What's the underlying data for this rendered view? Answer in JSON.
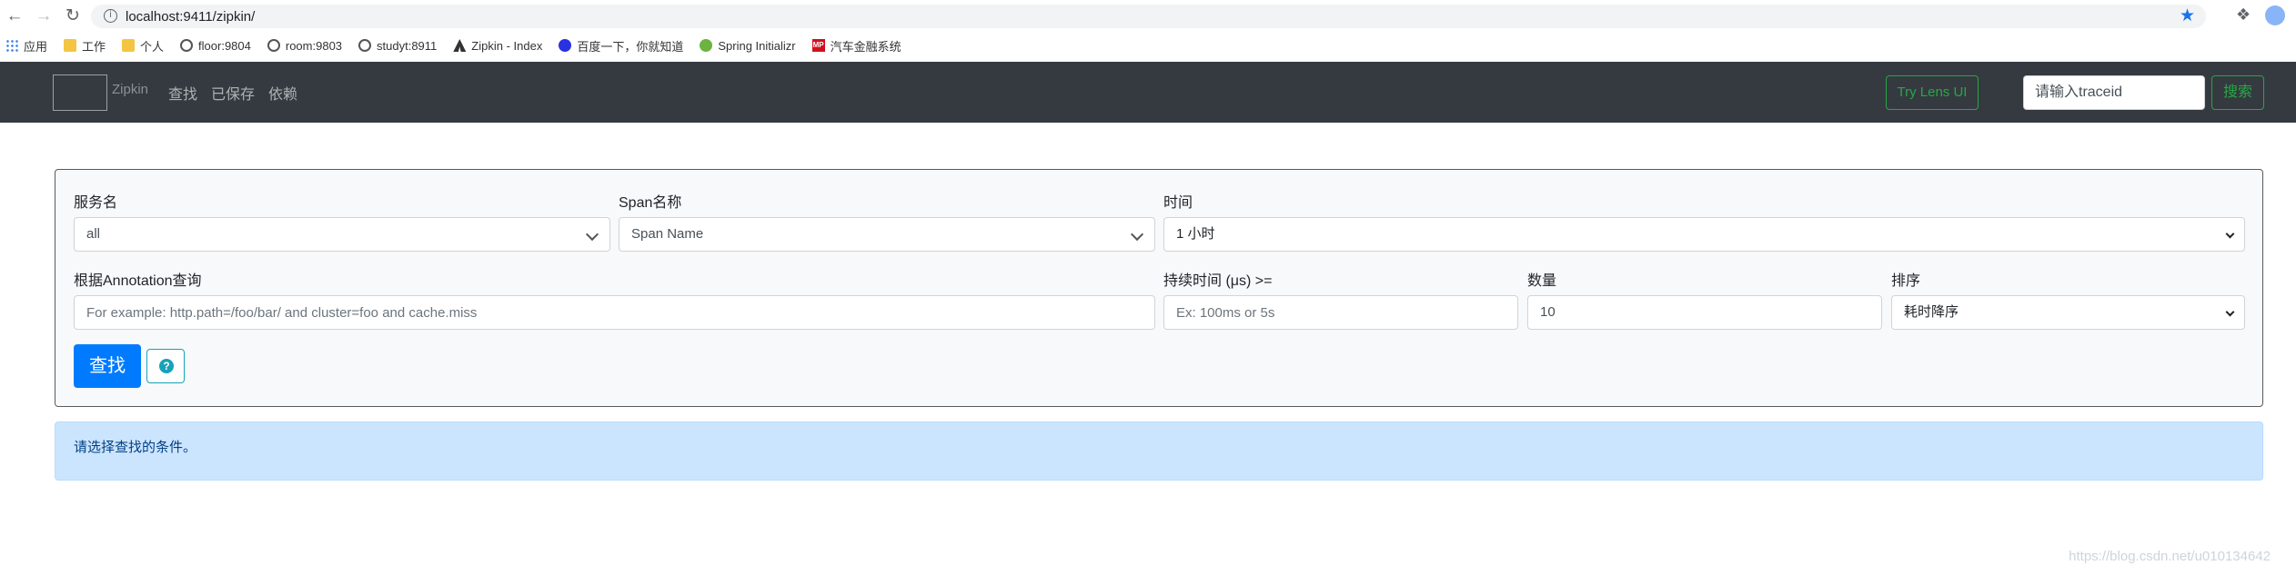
{
  "browser": {
    "url": "localhost:9411/zipkin/",
    "bookmarks": [
      {
        "icon": "apps-icon",
        "label": "应用"
      },
      {
        "icon": "folder-icon",
        "label": "工作"
      },
      {
        "icon": "folder-icon",
        "label": "个人"
      },
      {
        "icon": "globe-icon",
        "label": "floor:9804"
      },
      {
        "icon": "globe-icon",
        "label": "room:9803"
      },
      {
        "icon": "globe-icon",
        "label": "studyt:8911"
      },
      {
        "icon": "zipkin-icon",
        "label": "Zipkin - Index"
      },
      {
        "icon": "baidu-icon",
        "label": "百度一下，你就知道"
      },
      {
        "icon": "spring-icon",
        "label": "Spring Initializr"
      },
      {
        "icon": "mp-icon",
        "label": "汽车金融系统"
      }
    ]
  },
  "navbar": {
    "brand": "Zipkin",
    "links": [
      "查找",
      "已保存",
      "依赖"
    ],
    "lens_button": "Try Lens UI",
    "traceid_placeholder": "请输入traceid",
    "search_button": "搜索"
  },
  "form": {
    "service_label": "服务名",
    "service_value": "all",
    "span_label": "Span名称",
    "span_value": "Span Name",
    "time_label": "时间",
    "time_value": "1 小时",
    "annotation_label": "根据Annotation查询",
    "annotation_placeholder": "For example: http.path=/foo/bar/ and cluster=foo and cache.miss",
    "duration_label": "持续时间 (μs) >=",
    "duration_placeholder": "Ex: 100ms or 5s",
    "limit_label": "数量",
    "limit_value": "10",
    "sort_label": "排序",
    "sort_value": "耗时降序",
    "find_button": "查找",
    "help_icon": "?"
  },
  "alert": {
    "text": "请选择查找的条件。"
  },
  "watermark": "https://blog.csdn.net/u010134642",
  "colors": {
    "navbar_bg": "#343a40",
    "primary": "#007bff",
    "success": "#28a745",
    "alert_bg": "#cce5ff",
    "help": "#17a2b8"
  }
}
